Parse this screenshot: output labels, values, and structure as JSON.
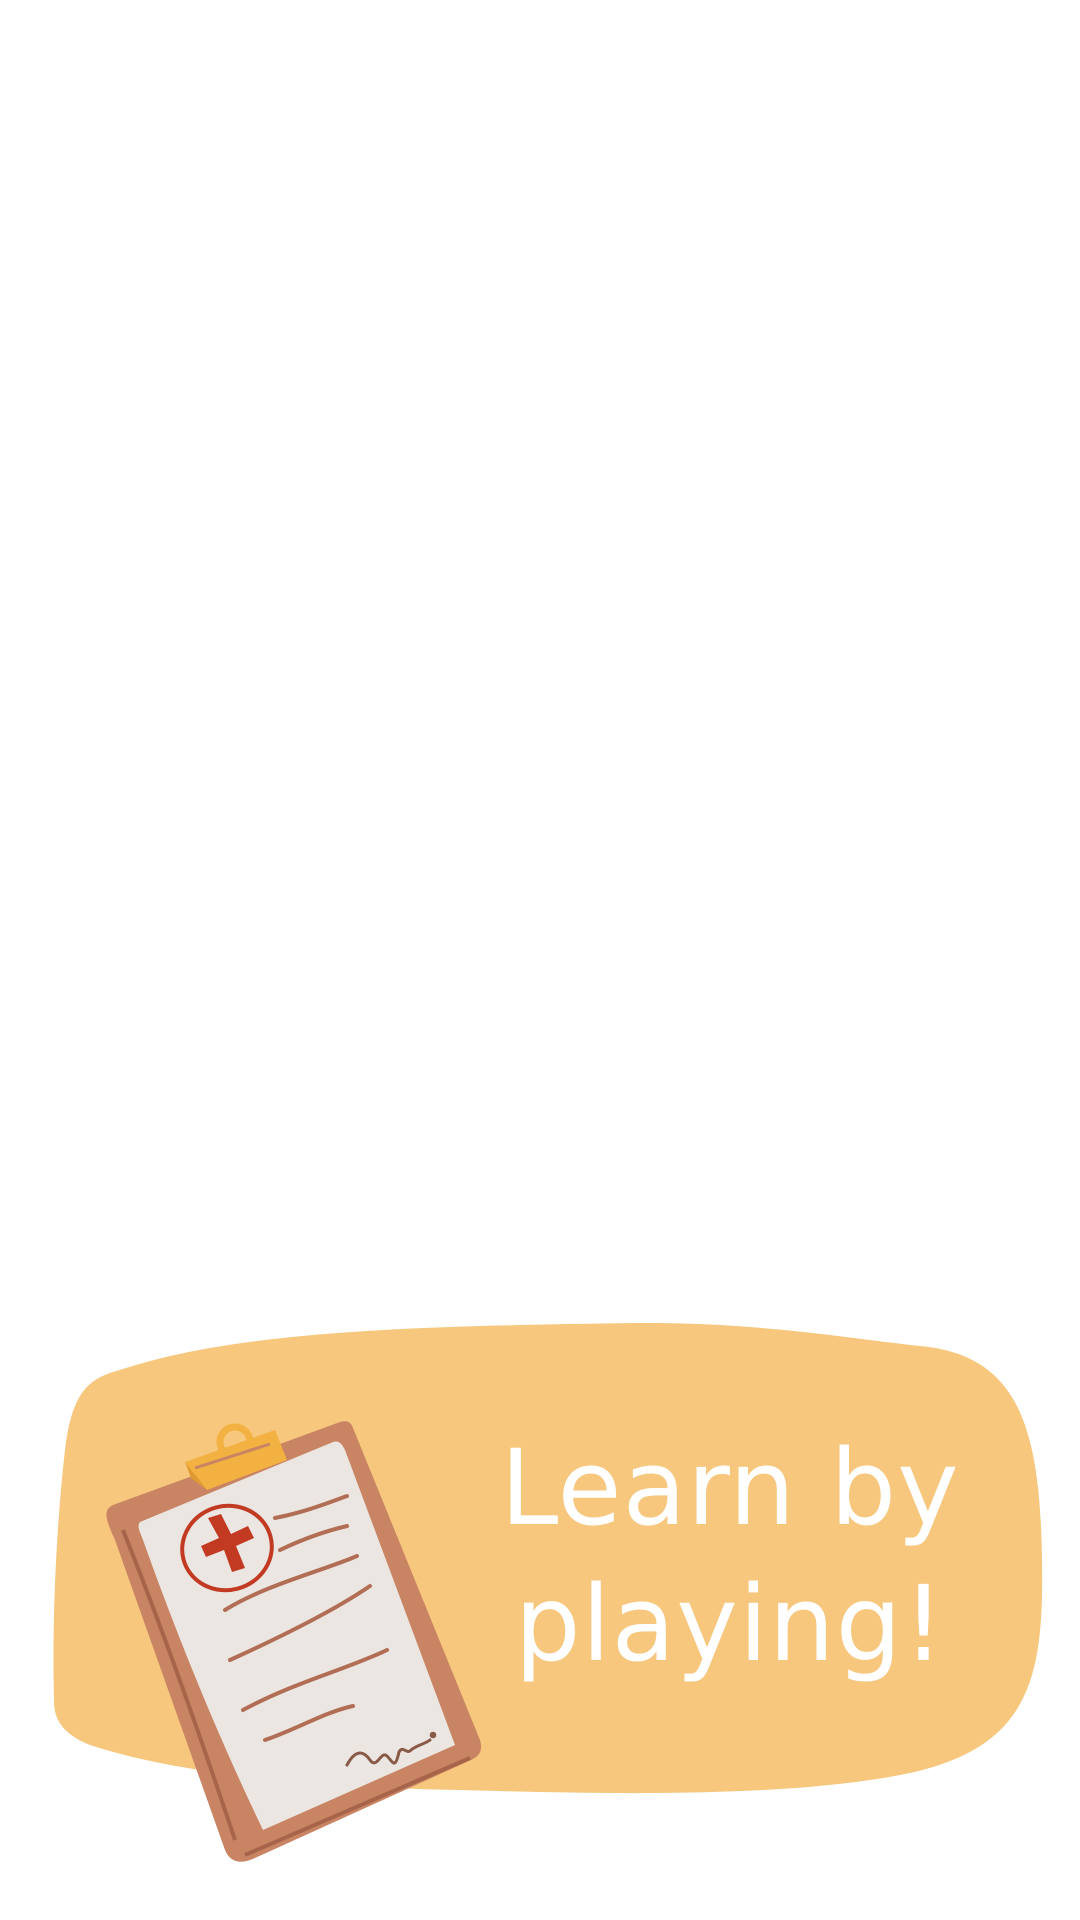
{
  "headline": {
    "line1": "Learn by",
    "line2": "playing!"
  },
  "colors": {
    "background": "#ffffff",
    "banner": "#F6C77D",
    "headline_text": "#ffffff",
    "clipboard_board": "#C98463",
    "clipboard_paper": "#EBE6E2",
    "clip": "#F3B142",
    "medical_cross": "#C23A22"
  },
  "icons": {
    "illustration": "clipboard-medical-icon"
  }
}
